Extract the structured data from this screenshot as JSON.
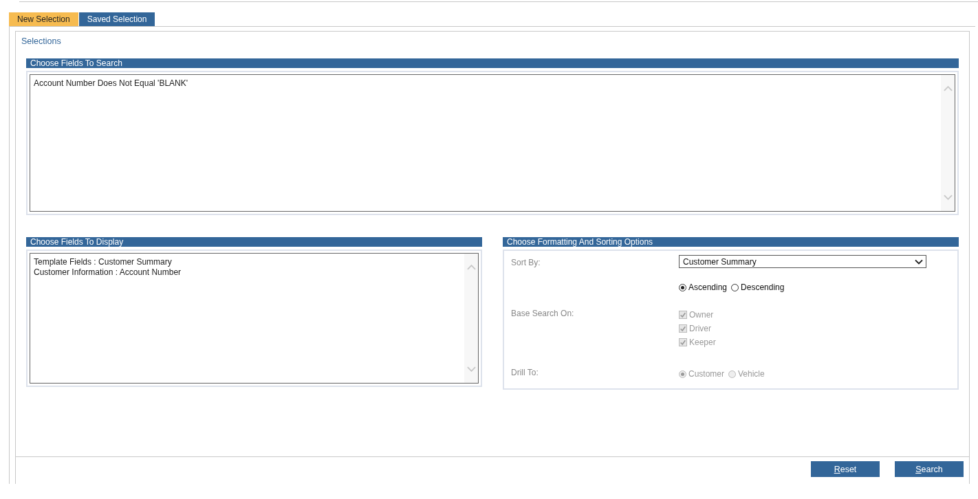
{
  "tabs": [
    {
      "label": "New Selection",
      "selected": true
    },
    {
      "label": "Saved Selection",
      "selected": false
    }
  ],
  "panel_title": "Selections",
  "search_section": {
    "title": "Choose Fields To Search",
    "lines": [
      "Account Number Does Not Equal 'BLANK'"
    ]
  },
  "display_section": {
    "title": "Choose Fields To Display",
    "lines": [
      "Template Fields : Customer Summary",
      "Customer Information : Account Number"
    ]
  },
  "options_section": {
    "title": "Choose Formatting And Sorting Options",
    "sort_by": {
      "label": "Sort By:",
      "value": "Customer Summary"
    },
    "order": [
      {
        "label": "Ascending",
        "selected": true,
        "disabled": false
      },
      {
        "label": "Descending",
        "selected": false,
        "disabled": false
      }
    ],
    "base_search": {
      "label": "Base Search On:",
      "options": [
        {
          "label": "Owner",
          "checked": true,
          "disabled": true
        },
        {
          "label": "Driver",
          "checked": true,
          "disabled": true
        },
        {
          "label": "Keeper",
          "checked": true,
          "disabled": true
        }
      ]
    },
    "drill_to": {
      "label": "Drill To:",
      "options": [
        {
          "label": "Customer",
          "selected": true,
          "disabled": true
        },
        {
          "label": "Vehicle",
          "selected": false,
          "disabled": true
        }
      ]
    }
  },
  "buttons": [
    {
      "label": "Reset"
    },
    {
      "label": "Search"
    }
  ]
}
